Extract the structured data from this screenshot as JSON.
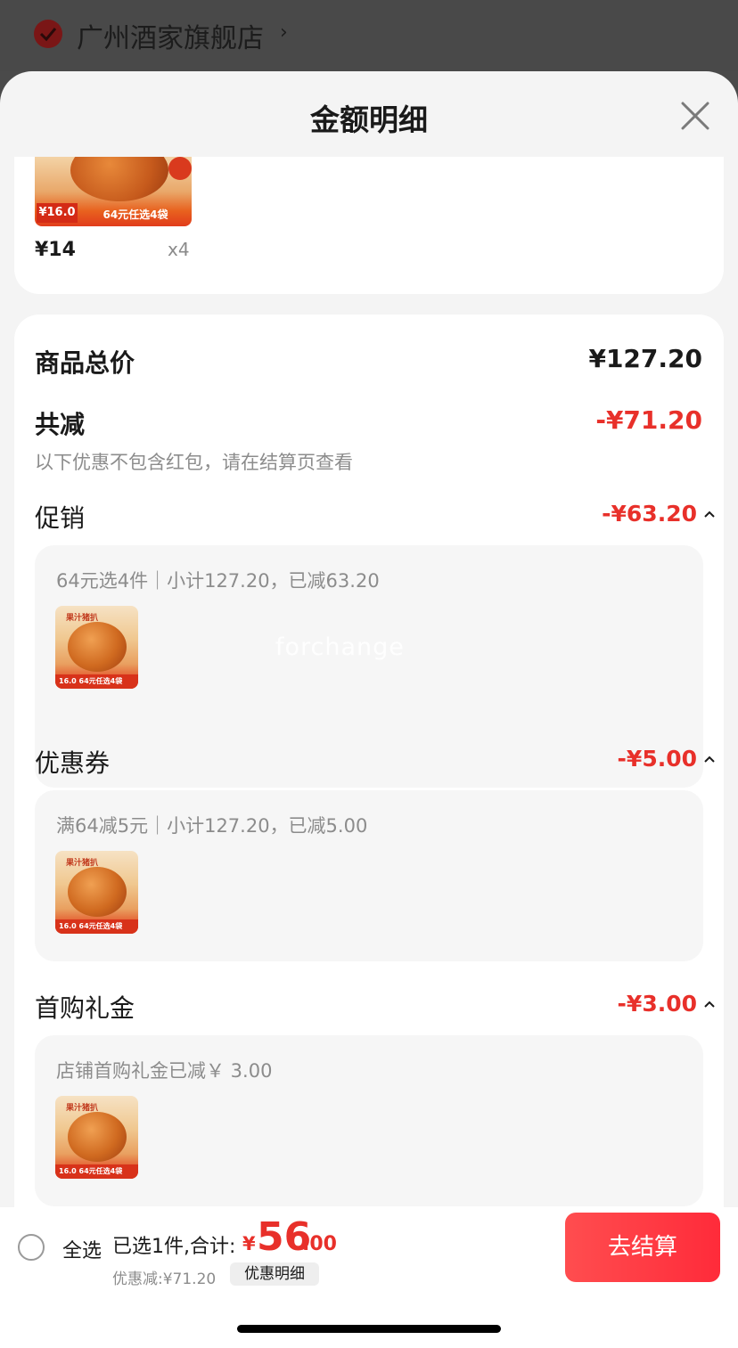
{
  "store": {
    "name": "广州酒家旗舰店",
    "chevron": "›"
  },
  "sheet": {
    "title": "金额明细"
  },
  "product": {
    "price": "¥14",
    "quantity": "x4",
    "thumb_badge": "¥16.0",
    "thumb_promo": "64元任选4袋"
  },
  "summary": {
    "total_label": "商品总价",
    "total_value": "¥127.20",
    "reduce_label": "共减",
    "reduce_value": "-¥71.20",
    "note": "以下优惠不包含红包，请在结算页查看"
  },
  "sections": [
    {
      "label": "促销",
      "value": "-¥63.20",
      "detail": "64元选4件｜小计127.20，已减63.20"
    },
    {
      "label": "优惠券",
      "value": "-¥5.00",
      "detail": "满64减5元｜小计127.20，已减5.00"
    },
    {
      "label": "首购礼金",
      "value": "-¥3.00",
      "detail": "店铺首购礼金已减￥ 3.00"
    }
  ],
  "thumb_small": {
    "ribbon": "果汁猪扒",
    "foot": "16.0  64元任选4袋"
  },
  "watermark": "forchange",
  "bottom_bar": {
    "select_all": "全选",
    "summary": "已选1件,合计:",
    "currency": "¥",
    "total_int": "56",
    "total_dec": ".00",
    "discount": "优惠减:¥71.20",
    "detail_link": "优惠明细",
    "checkout": "去结算"
  },
  "colors": {
    "accent_red": "#e8302a",
    "button_red": "#ff3b3f"
  }
}
